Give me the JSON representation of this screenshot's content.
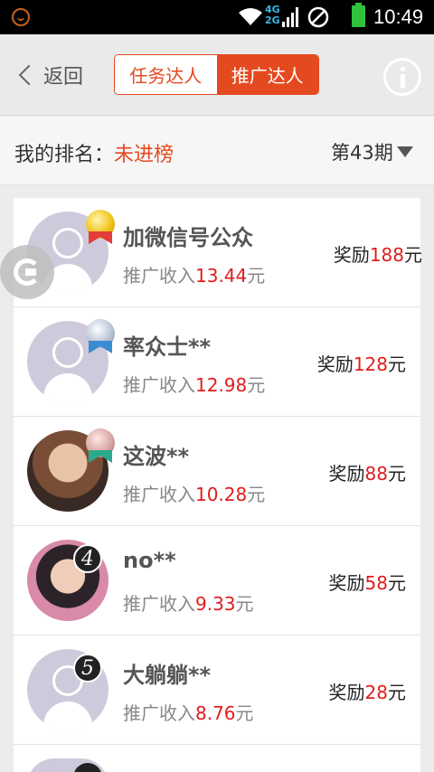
{
  "status_bar": {
    "time": "10:49",
    "network": [
      "4G",
      "2G"
    ]
  },
  "header": {
    "back_label": "返回",
    "tabs": [
      {
        "label": "任务达人",
        "active": false
      },
      {
        "label": "推广达人",
        "active": true
      }
    ],
    "accent_color": "#e44a20"
  },
  "ranking": {
    "label": "我的排名：",
    "value": "未进榜",
    "period": "第43期"
  },
  "list": [
    {
      "rank": 1,
      "medal": "gold",
      "name": "加微信号公众",
      "income_label": "推广收入",
      "income": "13.44",
      "income_unit": "元",
      "reward_label": "奖励",
      "reward": "188",
      "reward_unit": "元"
    },
    {
      "rank": 2,
      "medal": "silver",
      "name": "率众士**",
      "income_label": "推广收入",
      "income": "12.98",
      "income_unit": "元",
      "reward_label": "奖励",
      "reward": "128",
      "reward_unit": "元"
    },
    {
      "rank": 3,
      "medal": "bronze",
      "name": "这波**",
      "income_label": "推广收入",
      "income": "10.28",
      "income_unit": "元",
      "reward_label": "奖励",
      "reward": "88",
      "reward_unit": "元"
    },
    {
      "rank": 4,
      "badge": "4",
      "name": "no**",
      "income_label": "推广收入",
      "income": "9.33",
      "income_unit": "元",
      "reward_label": "奖励",
      "reward": "58",
      "reward_unit": "元"
    },
    {
      "rank": 5,
      "badge": "5",
      "name": "大躺躺**",
      "income_label": "推广收入",
      "income": "8.76",
      "income_unit": "元",
      "reward_label": "奖励",
      "reward": "28",
      "reward_unit": "元"
    }
  ]
}
